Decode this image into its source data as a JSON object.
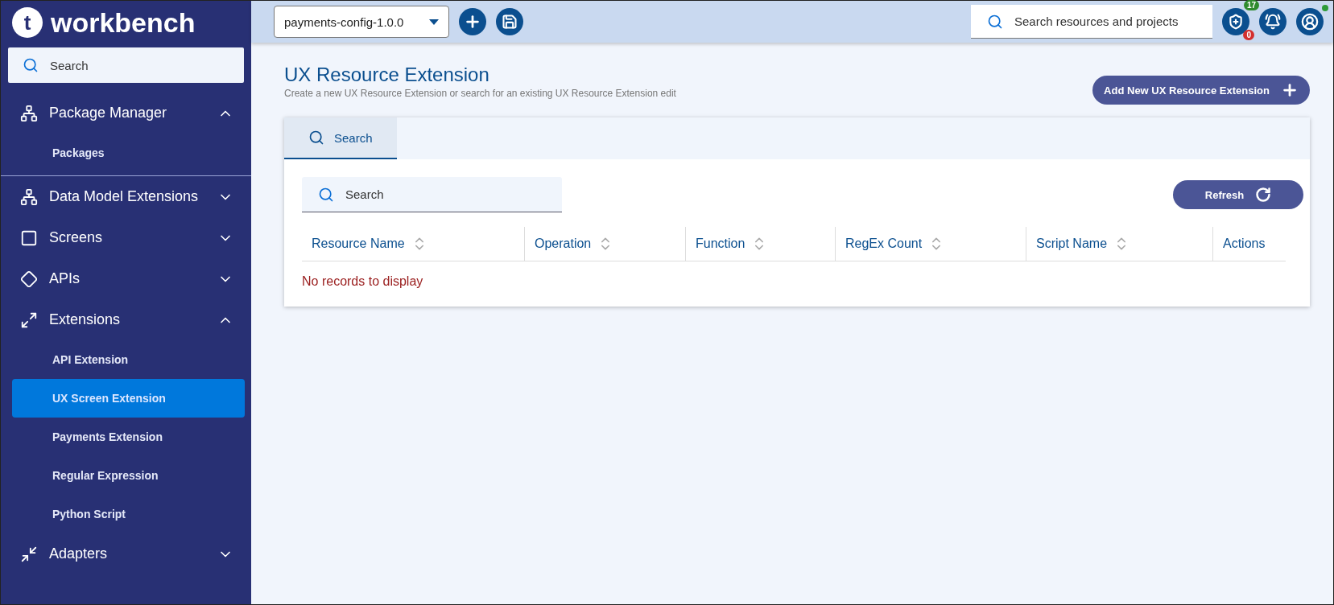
{
  "brand": {
    "logo_letter": "t",
    "name": "workbench"
  },
  "sidebar": {
    "search": {
      "placeholder": "Search"
    },
    "items": [
      {
        "kind": "group",
        "label": "Package Manager",
        "expanded": true,
        "children": [
          {
            "label": "Packages",
            "selected": false
          }
        ]
      },
      {
        "kind": "group",
        "label": "Data Model Extensions",
        "expanded": false
      },
      {
        "kind": "group",
        "label": "Screens",
        "expanded": false
      },
      {
        "kind": "group",
        "label": "APIs",
        "expanded": false
      },
      {
        "kind": "group",
        "label": "Extensions",
        "expanded": true,
        "children": [
          {
            "label": "API Extension",
            "selected": false
          },
          {
            "label": "UX Screen Extension",
            "selected": true
          },
          {
            "label": "Payments Extension",
            "selected": false
          },
          {
            "label": "Regular Expression",
            "selected": false
          },
          {
            "label": "Python Script",
            "selected": false
          }
        ]
      },
      {
        "kind": "group",
        "label": "Adapters",
        "expanded": false
      }
    ]
  },
  "topbar": {
    "project": "payments-config-1.0.0",
    "search": {
      "placeholder": "Search resources and projects"
    },
    "badges": {
      "green": "17",
      "red": "0"
    },
    "online": true
  },
  "page": {
    "title": "UX Resource Extension",
    "subtitle": "Create a new UX Resource Extension or search for an existing UX Resource Extension edit",
    "add_button": "Add New UX Resource Extension"
  },
  "tabs": [
    {
      "label": "Search",
      "selected": true
    }
  ],
  "search": {
    "placeholder": "Search"
  },
  "refresh_button": "Refresh",
  "table": {
    "columns": [
      {
        "label": "Resource Name",
        "sortable": true
      },
      {
        "label": "Operation",
        "sortable": true
      },
      {
        "label": "Function",
        "sortable": true
      },
      {
        "label": "RegEx Count",
        "sortable": true
      },
      {
        "label": "Script Name",
        "sortable": true
      },
      {
        "label": "Actions",
        "sortable": false
      }
    ],
    "empty_message": "No records to display"
  }
}
